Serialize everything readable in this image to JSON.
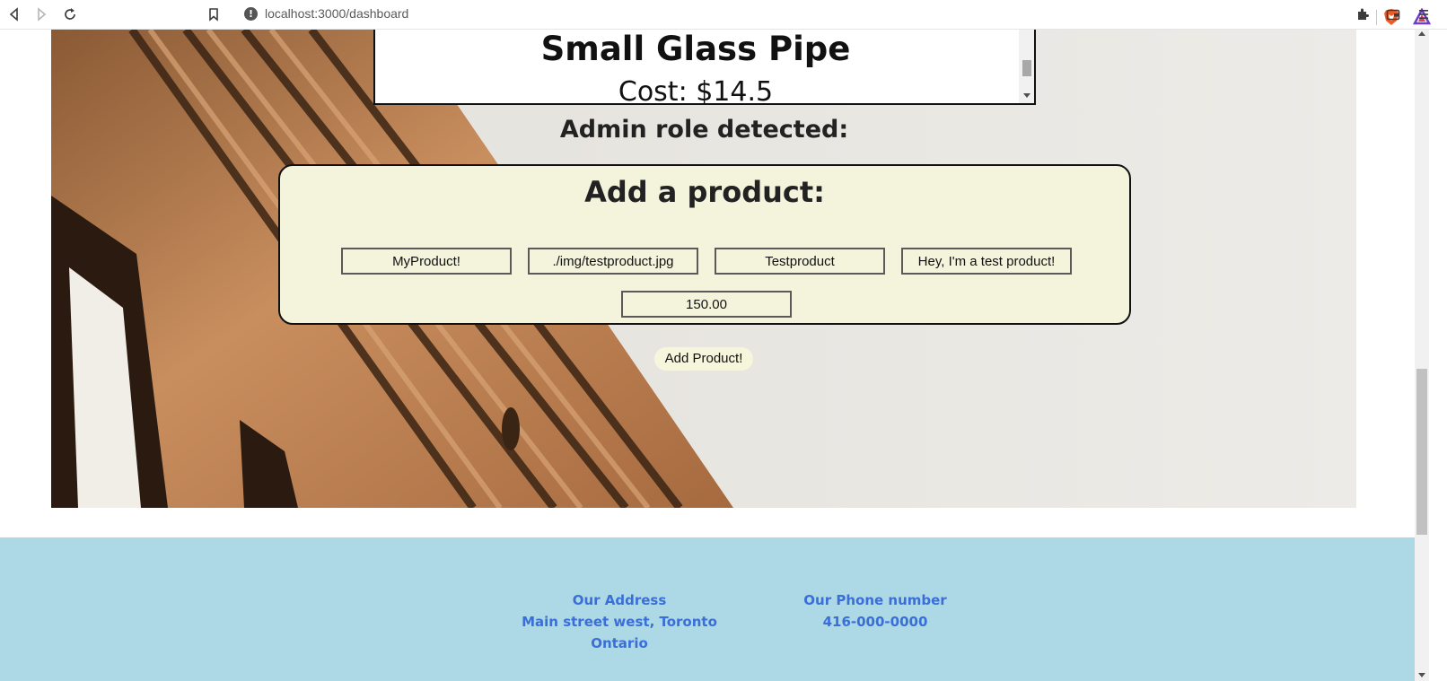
{
  "browser": {
    "url": "localhost:3000/dashboard"
  },
  "product_list": {
    "name": "Small Glass Pipe",
    "cost": "Cost: $14.5"
  },
  "admin_note": "Admin role detected:",
  "add_product": {
    "title": "Add a product:",
    "fields": {
      "name": "MyProduct!",
      "image": "./img/testproduct.jpg",
      "category": "Testproduct",
      "description": "Hey, I'm a test product!",
      "price": "150.00"
    },
    "submit_label": "Add Product!"
  },
  "footer": {
    "address_heading": "Our Address",
    "address_value": "Main street west, Toronto Ontario",
    "phone_heading": "Our Phone number",
    "phone_value": "416-000-0000"
  },
  "colors": {
    "footer_bg": "#add8e6",
    "footer_text": "#3a6fd8",
    "panel_bg": "#f4f4dc"
  }
}
